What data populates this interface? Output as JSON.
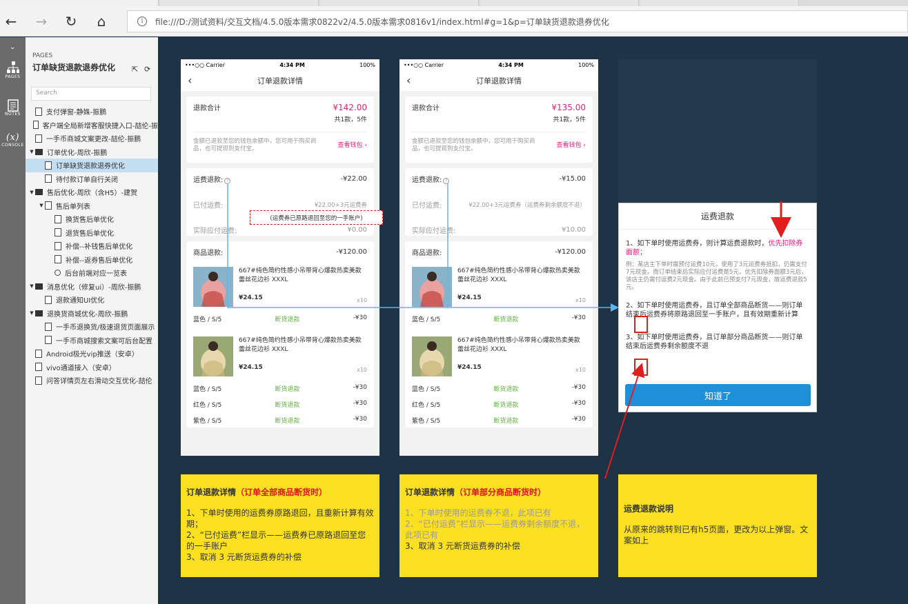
{
  "browser": {
    "url": "file:///D:/测试资料/交互文档/4.5.0版本需求0822v2/4.5.0版本需求0816v1/index.html#g=1&p=订单缺货退款退券优化",
    "info_label": "i"
  },
  "leftbar": {
    "pages_label": "PAGES",
    "notes_label": "NOTES",
    "console_label": "CONSOLE",
    "console_symbol": "(x)"
  },
  "pages_panel": {
    "header": "PAGES",
    "title": "订单缺货退款退券优化",
    "search_placeholder": "Search",
    "tree": [
      {
        "label": "支付弹窗-静姝-振鹏",
        "depth": 0,
        "type": "page",
        "toggle": ""
      },
      {
        "label": "客户端全局新增客服快捷入口-喆伦-振",
        "depth": 0,
        "type": "page",
        "toggle": ""
      },
      {
        "label": "一手币商城文案更改-喆伦-振鹏",
        "depth": 0,
        "type": "page",
        "toggle": ""
      },
      {
        "label": "订单优化-周欣-振鹏",
        "depth": 0,
        "type": "folder",
        "toggle": "▼"
      },
      {
        "label": "订单缺货退款退券优化",
        "depth": 1,
        "type": "page",
        "toggle": "",
        "selected": true
      },
      {
        "label": "待付款订单自行关闭",
        "depth": 1,
        "type": "page",
        "toggle": ""
      },
      {
        "label": "售后优化-周欣（含H5）-建贺",
        "depth": 0,
        "type": "folder",
        "toggle": "▼"
      },
      {
        "label": "售后单列表",
        "depth": 1,
        "type": "page",
        "toggle": "▼"
      },
      {
        "label": "换货售后单优化",
        "depth": 2,
        "type": "page",
        "toggle": ""
      },
      {
        "label": "退货售后单优化",
        "depth": 2,
        "type": "page",
        "toggle": ""
      },
      {
        "label": "补偿--补钱售后单优化",
        "depth": 2,
        "type": "page",
        "toggle": ""
      },
      {
        "label": "补偿--返券售后单优化",
        "depth": 2,
        "type": "page",
        "toggle": ""
      },
      {
        "label": "后台前端对应一览表",
        "depth": 2,
        "type": "flow",
        "toggle": ""
      },
      {
        "label": "消息优化（修复ui）-周欣-振鹏",
        "depth": 0,
        "type": "folder",
        "toggle": "▼"
      },
      {
        "label": "退款通知UI优化",
        "depth": 1,
        "type": "page",
        "toggle": ""
      },
      {
        "label": "退换货商城优化-周欣-振鹏",
        "depth": 0,
        "type": "folder",
        "toggle": "▼"
      },
      {
        "label": "一手币退换货/极速退货页面展示",
        "depth": 1,
        "type": "page",
        "toggle": ""
      },
      {
        "label": "一手币商城搜索文案可后台配置",
        "depth": 1,
        "type": "page",
        "toggle": ""
      },
      {
        "label": "Android极光vip推送（安卓）",
        "depth": 0,
        "type": "page",
        "toggle": ""
      },
      {
        "label": "vivo通道接入（安卓）",
        "depth": 0,
        "type": "page",
        "toggle": ""
      },
      {
        "label": "问答详情页左右滑动交互优化-喆伦",
        "depth": 0,
        "type": "page",
        "toggle": ""
      }
    ]
  },
  "phones": [
    {
      "status": {
        "carrier": "•••○○ Carrier",
        "time": "4:34 PM",
        "battery": "100%"
      },
      "nav_title": "订单退款详情",
      "total_label": "退款合计",
      "total_value": "¥142.00",
      "total_count": "共1款，5件",
      "wallet_note": "金额已退款至您的钱包余额中，您可用于购买商品，也可提现到支付宝。",
      "wallet_link": "查看钱包 ›",
      "freight_label": "运费退款:",
      "freight_value": "-¥22.00",
      "paid_label": "已付运费:",
      "paid_value": "¥22.00+3元运费券",
      "actual_label": "实际应付运费:",
      "actual_value": "¥0.00",
      "goods_label": "商品退款:",
      "goods_value": "-¥120.00",
      "products": [
        {
          "name": "667#纯色简约性感小吊带背心爆款热卖美款蕾丝花边衫 XXXL",
          "price": "¥24.15",
          "qty": "x10",
          "subs": [
            {
              "spec": "蓝色 / S/5",
              "status": "断货退款",
              "amount": "-¥30"
            }
          ]
        },
        {
          "name": "667#纯色简约性感小吊带背心爆款热卖美款蕾丝花边衫 XXXL",
          "price": "¥24.15",
          "qty": "x10",
          "subs": [
            {
              "spec": "蓝色 / S/5",
              "status": "断货退款",
              "amount": "-¥30"
            },
            {
              "spec": "红色 / S/5",
              "status": "断货退款",
              "amount": "-¥30"
            },
            {
              "spec": "紫色 / S/5",
              "status": "断货退款",
              "amount": "-¥30"
            }
          ]
        }
      ]
    },
    {
      "status": {
        "carrier": "•••○○ Carrier",
        "time": "4:34 PM",
        "battery": "100%"
      },
      "nav_title": "订单退款详情",
      "total_label": "退款合计",
      "total_value": "¥135.00",
      "total_count": "共1款，5件",
      "wallet_note": "金额已退款至您的钱包余额中，您可用于购买商品，也可提现到支付宝。",
      "wallet_link": "查看钱包 ›",
      "freight_label": "运费退款:",
      "freight_value": "-¥15.00",
      "paid_label": "已付运费:",
      "paid_value": "¥22.00+3元运费券（运费券剩余额度不退）",
      "actual_label": "实际应付运费:",
      "actual_value": "¥10.00",
      "goods_label": "商品退款:",
      "goods_value": "-¥120.00",
      "products": [
        {
          "name": "667#纯色简约性感小吊带背心爆款热卖美款蕾丝花边衫 XXXL",
          "price": "¥24.15",
          "qty": "x10",
          "subs": [
            {
              "spec": "蓝色 / S/5",
              "status": "断货退款",
              "amount": "-¥30"
            }
          ]
        },
        {
          "name": "667#纯色简约性感小吊带背心爆款热卖美款蕾丝花边衫 XXXL",
          "price": "¥24.15",
          "qty": "x10",
          "subs": [
            {
              "spec": "蓝色 / S/5",
              "status": "断货退款",
              "amount": "-¥30"
            },
            {
              "spec": "红色 / S/5",
              "status": "断货退款",
              "amount": "-¥30"
            },
            {
              "spec": "紫色 / S/5",
              "status": "断货退款",
              "amount": "-¥30"
            }
          ]
        }
      ]
    }
  ],
  "annotation_box": "(运费券已原路退回至您的一手账户)",
  "dialog": {
    "title": "运费退款",
    "p1_a": "1、如下单时使用运费券，则计算运费退款时，",
    "p1_b": "优先扣除券面额；",
    "example": "例：某店主下单时需预付运费10元，使用了3元运费券抵扣，仍需支付7元现金。而订单结束后实际应付运费是5元，优先扣除券面额3元后，该店主仍需付运费2元现金。由于此前已预支付7元现金，故运费退款5元。",
    "p2": "2、如下单时使用运费券，且订单全部商品断货——则订单结束后运费券将原路退回至一手账户，且有效期重新计算",
    "p3": "3、如下单时使用运费券，且订单部分商品断货——则订单结束后运费券剩余额度不退",
    "button": "知道了"
  },
  "notes": [
    {
      "title": "订单退款详情",
      "title_red": "（订单全部商品断货时）",
      "lines": [
        "1、下单时使用的运费券原路退回，且重新计算有效期；",
        "2、“已付运费”栏显示——运费券已原路退回至您的一手账户",
        "3、取消 3 元断货运费券的补偿"
      ]
    },
    {
      "title": "订单退款详情",
      "title_red": "（订单部分商品断货时）",
      "lines": [
        "1、下单时使用的运费券不退，此项已有",
        "2、“已付运费”栏显示——运费券剩余额度不退，此项已有",
        "3、取消 3 元断货运费券的补偿"
      ]
    },
    {
      "title": "运费退款说明",
      "title_red": "",
      "lines": [
        "从原来的跳转到已有h5页面，更改为以上弹窗。文案如上"
      ]
    }
  ],
  "colors": {
    "accent_pink": "#e5207b",
    "green": "#67b346",
    "note_yellow": "#fbe021",
    "button_blue": "#1e8fd8",
    "canvas": "#1f3346",
    "annotation_red": "#e01e1e"
  }
}
